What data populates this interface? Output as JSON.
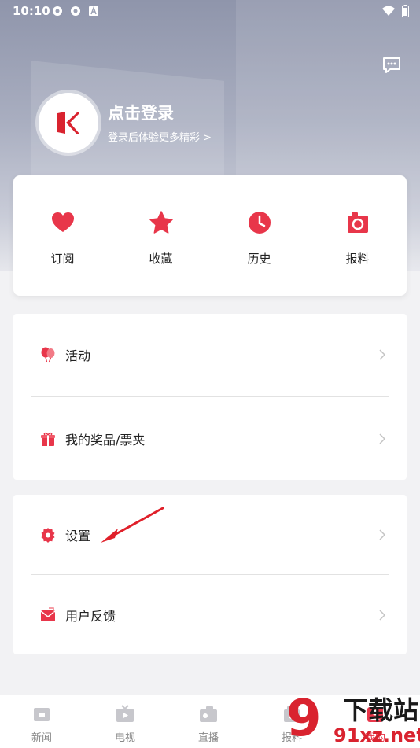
{
  "status_bar": {
    "time": "10:10"
  },
  "profile": {
    "title": "点击登录",
    "subtitle": "登录后体验更多精彩 >"
  },
  "quick_actions": [
    {
      "label": "订阅",
      "icon": "heart-icon"
    },
    {
      "label": "收藏",
      "icon": "star-icon"
    },
    {
      "label": "历史",
      "icon": "clock-icon"
    },
    {
      "label": "报料",
      "icon": "camera-icon"
    }
  ],
  "list_group_1": [
    {
      "label": "活动",
      "icon": "balloon-icon"
    },
    {
      "label": "我的奖品/票夹",
      "icon": "gift-icon"
    }
  ],
  "list_group_2": [
    {
      "label": "设置",
      "icon": "gear-icon"
    },
    {
      "label": "用户反馈",
      "icon": "mail-icon"
    }
  ],
  "bottom_nav": [
    {
      "label": "新闻",
      "icon": "news-icon"
    },
    {
      "label": "电视",
      "icon": "tv-icon"
    },
    {
      "label": "直播",
      "icon": "live-camera-icon"
    },
    {
      "label": "报料",
      "icon": "report-icon"
    },
    {
      "label": "我的",
      "icon": "profile-icon"
    }
  ],
  "watermark": {
    "brand": "下载站",
    "domain": "91xz.net",
    "mark": "9"
  },
  "colors": {
    "accent": "#e8364a",
    "icon_gray": "#c7c7cc"
  }
}
